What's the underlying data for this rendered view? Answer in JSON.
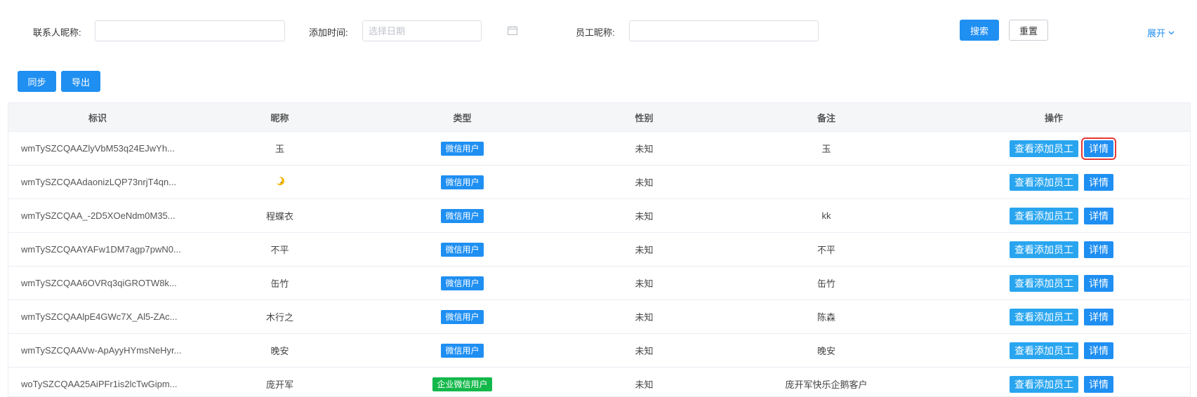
{
  "filters": {
    "contact_nickname_label": "联系人昵称:",
    "contact_nickname_value": "",
    "add_time_label": "添加时间:",
    "add_time_placeholder": "选择日期",
    "staff_nickname_label": "员工昵称:",
    "staff_nickname_value": "",
    "search_label": "搜索",
    "reset_label": "重置",
    "expand_label": "展开"
  },
  "toolbar": {
    "sync_label": "同步",
    "export_label": "导出"
  },
  "table": {
    "columns": [
      "标识",
      "昵称",
      "类型",
      "性别",
      "备注",
      "操作"
    ],
    "view_staff_label": "查看添加员工",
    "detail_label": "详情",
    "rows": [
      {
        "id": "wmTySZCQAAZlyVbM53q24EJwYh...",
        "nickname": "玉",
        "type": "微信用户",
        "gender": "未知",
        "remark": "玉"
      },
      {
        "id": "wmTySZCQAAdaonizLQP73nrjT4qn...",
        "nickname": "",
        "type": "微信用户",
        "gender": "未知",
        "remark": ""
      },
      {
        "id": "wmTySZCQAA_-2D5XOeNdm0M35...",
        "nickname": "程蝶衣",
        "type": "微信用户",
        "gender": "未知",
        "remark": "kk"
      },
      {
        "id": "wmTySZCQAAYAFw1DM7agp7pwN0...",
        "nickname": "不平",
        "type": "微信用户",
        "gender": "未知",
        "remark": "不平"
      },
      {
        "id": "wmTySZCQAA6OVRq3qiGROTW8k...",
        "nickname": "缶竹",
        "type": "微信用户",
        "gender": "未知",
        "remark": "缶竹"
      },
      {
        "id": "wmTySZCQAAlpE4GWc7X_Al5-ZAc...",
        "nickname": "木行之",
        "type": "微信用户",
        "gender": "未知",
        "remark": "陈森"
      },
      {
        "id": "wmTySZCQAAVw-ApAyyHYmsNeHyr...",
        "nickname": "晚安",
        "type": "微信用户",
        "gender": "未知",
        "remark": "晚安"
      },
      {
        "id": "woTySZCQAA25AiPFr1is2lcTwGipm...",
        "nickname": "庞开军",
        "type": "企业微信用户",
        "gender": "未知",
        "remark": "庞开军快乐企鹅客户"
      }
    ]
  },
  "colors": {
    "primary": "#1f8ff2",
    "wechat_tag": "#1f8ff2",
    "enterprise_tag": "#13b84a",
    "view_button": "#29a5f0",
    "highlight_box": "#e53935"
  }
}
